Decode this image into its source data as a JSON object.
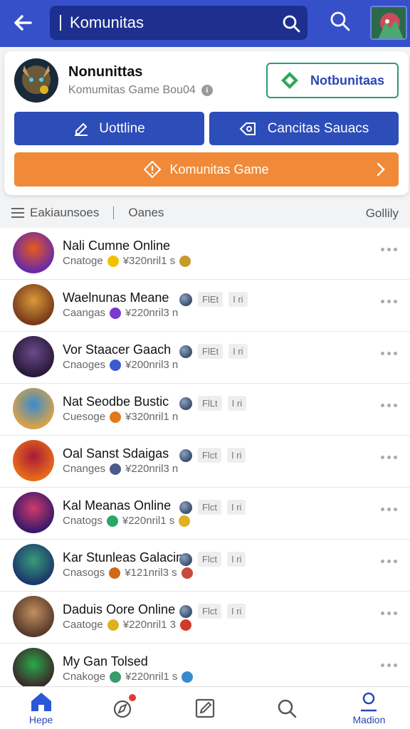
{
  "header": {
    "search_value": "Komunitas",
    "back_icon": "arrow-left-icon",
    "search_icon": "search-icon"
  },
  "card": {
    "title": "Nonunittas",
    "subtitle": "Komumitas Game Bou04",
    "follow_label": "Notbunitaas",
    "btn_left_label": "Uottline",
    "btn_right_label": "Cancitas Sauacs",
    "btn_orange_label": "Komunitas Game"
  },
  "filterbar": {
    "item1": "Eakiaunsoes",
    "item2": "Oanes",
    "right": "Gollily"
  },
  "rows": [
    {
      "title": "Nali Cumne Online",
      "meta_label": "Cnatoge",
      "meta_value": "¥320nril1 s",
      "chips": [],
      "av": [
        "#6a2aa8",
        "#e85a1c"
      ],
      "mini": "#f2c200",
      "end": "#c89a2a"
    },
    {
      "title": "Waelnunas Meane",
      "meta_label": "Caangas",
      "meta_value": "¥220nril3 n",
      "chips": [
        "FlEt",
        "I ri"
      ],
      "av": [
        "#7a3b1a",
        "#d99a3a"
      ],
      "mini": "#7a3ad0",
      "end": null
    },
    {
      "title": "Vor Staacer Gaach",
      "meta_label": "Cnaoges",
      "meta_value": "¥200nril3 n",
      "chips": [
        "FlEt",
        "I ri"
      ],
      "av": [
        "#2a1a3a",
        "#6a4a8a"
      ],
      "mini": "#3a5ad0",
      "end": null
    },
    {
      "title": "Nat Seodbe Bustic",
      "meta_label": "Cuesoge",
      "meta_value": "¥320nril1 n",
      "chips": [
        "FlLt",
        "I ri"
      ],
      "av": [
        "#d6a24a",
        "#3a8ad0"
      ],
      "mini": "#e07a1a",
      "end": null
    },
    {
      "title": "Oal Sanst Sdaigas",
      "meta_label": "Cnanges",
      "meta_value": "¥220nril3 n",
      "chips": [
        "Flct",
        "I ri"
      ],
      "av": [
        "#e86a1a",
        "#a81a3a"
      ],
      "mini": "#4a5a8a",
      "end": null
    },
    {
      "title": "Kal Meanas Online",
      "meta_label": "Cnatogs",
      "meta_value": "¥220nril1 s",
      "chips": [
        "Flct",
        "I ri"
      ],
      "av": [
        "#3a1a6a",
        "#d03a6a"
      ],
      "mini": "#2aa86a",
      "end": "#e0b020"
    },
    {
      "title": "Kar Stunleas Galacins",
      "meta_label": "Cnasogs",
      "meta_value": "¥121nril3 s",
      "chips": [
        "Flct",
        "I ri"
      ],
      "av": [
        "#1a3a6a",
        "#3a9a7a"
      ],
      "mini": "#d06a1a",
      "end": "#c84a3a"
    },
    {
      "title": "Daduis Oore Online",
      "meta_label": "Caatoge",
      "meta_value": "¥220nril1 3",
      "chips": [
        "Flct",
        "I ri"
      ],
      "av": [
        "#5a3a2a",
        "#c09060"
      ],
      "mini": "#e0b020",
      "end": "#d03a2a"
    },
    {
      "title": "My Gan Tolsed",
      "meta_label": "Cnakoge",
      "meta_value": "¥220nril1 s",
      "chips": [],
      "av": [
        "#3a2a2a",
        "#2aa84a"
      ],
      "mini": "#3a9a6a",
      "end": "#3a8ad0"
    }
  ],
  "bottom_nav": [
    {
      "label": "Hepe",
      "icon": "home-icon"
    },
    {
      "label": "",
      "icon": "compass-icon"
    },
    {
      "label": "",
      "icon": "edit-icon"
    },
    {
      "label": "",
      "icon": "search-icon"
    },
    {
      "label": "Madion",
      "icon": "profile-icon"
    }
  ],
  "colors": {
    "primary": "#3550c9",
    "button_blue": "#2d4db8",
    "accent_orange": "#f08a38",
    "follow_border": "#2f9a72"
  }
}
